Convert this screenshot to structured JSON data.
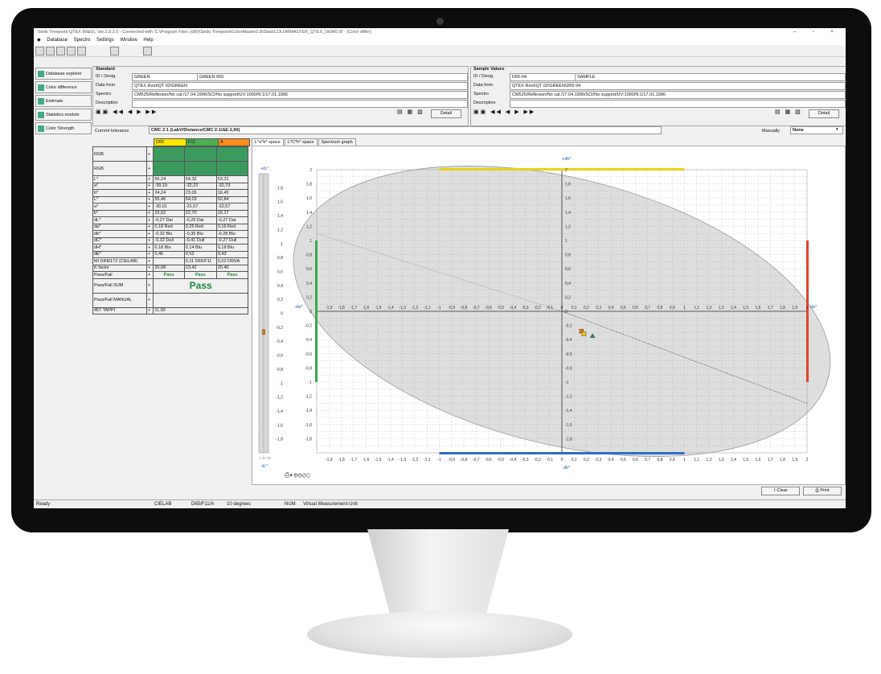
{
  "window": {
    "title": "Sedo Treepoint QTEX (M&S), Ver.2.8.2.0 - Connected with 'C:\\Program Files (x86)\\Sedo Treepoint\\ColorMaster2.8\\Data\\COLORMASTER_QTEX_DEMO.B' - [Color differ]",
    "menu": [
      "Database",
      "Spectro",
      "Settings",
      "Window",
      "Help"
    ]
  },
  "nav": [
    "Database explorer",
    "Color difference",
    "Estimate",
    "Statistics module",
    "Color Strength"
  ],
  "standard": {
    "header": "Standard",
    "id_label": "ID / Desig.",
    "id_value": "GREEN",
    "desig_value": "GREEN 665",
    "datafrom_label": "Data from",
    "datafrom_value": "QTEX Root\\QT 02\\GREEN",
    "spectro_label": "Spectro",
    "spectro_value": "CM525/Reflexion/No cal./17.04.1996/SCI/No support/UV:1000/N:1/17.01.1996",
    "desc_label": "Description",
    "detail": "Detail"
  },
  "sample": {
    "header": "Sample Values",
    "id_label": "ID / Desig.",
    "id_value": "D65-04",
    "desig_value": "SAMPLE",
    "datafrom_label": "Data from",
    "datafrom_value": "QTEX Root\\QT 02\\GREEN\\D65 04",
    "spectro_label": "Spectro",
    "spectro_value": "CM525/Reflexion/No cal./17.04.1996/SCI/No support/UV:1000/N:1/17.01.1996",
    "desc_label": "Description",
    "detail": "Detail"
  },
  "tolerance": {
    "label": "Current tolerance",
    "value": "CMC 2:1 (LabV/Distance/CMC 2:1/ΔE:1,00)",
    "manually_label": "Manually",
    "manually_value": "None"
  },
  "illuminants": [
    "D65",
    "F11",
    "A"
  ],
  "table_rows": [
    {
      "label": "RGB",
      "vals": [
        "",
        "",
        ""
      ]
    },
    {
      "label": "RGB",
      "vals": [
        "",
        "",
        ""
      ]
    },
    {
      "label": "L*",
      "vals": [
        "56,24",
        "54,32",
        "53,31"
      ]
    },
    {
      "label": "a*",
      "vals": [
        "-39,19",
        "-32,22",
        "-32,73"
      ]
    },
    {
      "label": "b*",
      "vals": [
        "24,24",
        "23,05",
        "16,45"
      ]
    },
    {
      "label": "L*",
      "vals": [
        "55,46",
        "54,03",
        "52,84"
      ]
    },
    {
      "label": "a*",
      "vals": [
        "-30,01",
        "-31,57",
        "-32,57"
      ]
    },
    {
      "label": "b*",
      "vals": [
        "23,92",
        "22,70",
        "16,17"
      ]
    },
    {
      "label": "dL*",
      "vals": [
        "-0,27 Dar",
        "-0,29 Dar",
        "-0,27 Dar"
      ]
    },
    {
      "label": "da*",
      "vals": [
        "0,18 Red",
        "0,25 Red",
        "0,16 Red"
      ]
    },
    {
      "label": "db*",
      "vals": [
        "-0,32 Blu",
        "-0,35 Blu",
        "-0,28 Blu"
      ]
    },
    {
      "label": "dC*",
      "vals": [
        "-0,32 Dull",
        "-0,41 Dull",
        "-0,27 Dull"
      ]
    },
    {
      "label": "dH*",
      "vals": [
        "0,18 Blu",
        "0,14 Blu",
        "0,18 Blu"
      ]
    },
    {
      "label": "dE*",
      "vals": [
        "0,46",
        "0,52",
        "0,43"
      ]
    },
    {
      "label": "MI DIN6172 (CIELAB)",
      "vals": [
        "",
        "0,11 D65/F11",
        "0,02 D65/A"
      ]
    },
    {
      "label": "K factor",
      "vals": [
        "20,08",
        "23,42",
        "20,40"
      ]
    },
    {
      "label": "Pass/Fail",
      "vals": [
        "Pass",
        "Pass",
        "Pass"
      ]
    }
  ],
  "extra_rows": {
    "sum_label": "Pass/Fail SUM",
    "sum_value": "Pass",
    "manual_label": "Pass/Fail MANUAL",
    "tappi_label": "457 TAPPI",
    "tappi_value": "11,00"
  },
  "tabs": [
    "L*a*b* space",
    "L*C*h* space",
    "Spectrum graph"
  ],
  "chart": {
    "top_label": "+db*",
    "bottom_label": "-db*",
    "left_label": "-da*",
    "right_label": "da*",
    "dl_top": "+dL*",
    "dl_bottom": "-dL*",
    "dl_tol": "1,00 dE"
  },
  "chart_data": {
    "type": "scatter",
    "x_ticks": [
      "-1,9",
      "-1,8",
      "-1,7",
      "-1,6",
      "-1,5",
      "-1,4",
      "-1,3",
      "-1,2",
      "-1,1",
      "-1",
      "-0,9",
      "-0,8",
      "-0,7",
      "-0,6",
      "-0,5",
      "-0,4",
      "-0,3",
      "-0,2",
      "-0,1",
      "0",
      "0,1",
      "0,2",
      "0,3",
      "0,4",
      "0,5",
      "0,6",
      "0,7",
      "0,8",
      "0,9",
      "1",
      "1,1",
      "1,2",
      "1,3",
      "1,4",
      "1,5",
      "1,6",
      "1,7",
      "1,8",
      "1,9",
      "2"
    ],
    "y_ticks": [
      "2",
      "1,8",
      "1,6",
      "1,4",
      "1,2",
      "1",
      "0,8",
      "0,6",
      "0,4",
      "0,2",
      "0",
      "-0,2",
      "-0,4",
      "-0,6",
      "-0,8",
      "-1",
      "-1,2",
      "-1,4",
      "-1,6",
      "-1,8"
    ],
    "dl_ticks": [
      "1,8",
      "1,6",
      "1,4",
      "1,2",
      "1",
      "0,8",
      "0,6",
      "0,4",
      "0,2",
      "0",
      "-0,2",
      "-0,4",
      "-0,6",
      "-0,8",
      "-1",
      "-1,2",
      "-1,4",
      "-1,6",
      "-1,8"
    ],
    "xlim": [
      -2,
      2
    ],
    "ylim": [
      -2,
      2
    ],
    "dl_lim": [
      -2,
      2
    ],
    "points": [
      {
        "x": 0.16,
        "y": -0.28,
        "color": "#e07b00"
      },
      {
        "x": 0.18,
        "y": -0.32,
        "color": "#f0c419"
      },
      {
        "x": 0.25,
        "y": -0.35,
        "color": "#2e8b57"
      }
    ],
    "dl_value": -0.27,
    "tolerance_ellipse": true
  },
  "buttons": {
    "clear": "Clear",
    "print": "Print"
  },
  "status": [
    "Ready",
    "CIELAB",
    "D65/F11/A",
    "10 degrees",
    "NUM",
    "Virtual Measurement-Unit"
  ]
}
